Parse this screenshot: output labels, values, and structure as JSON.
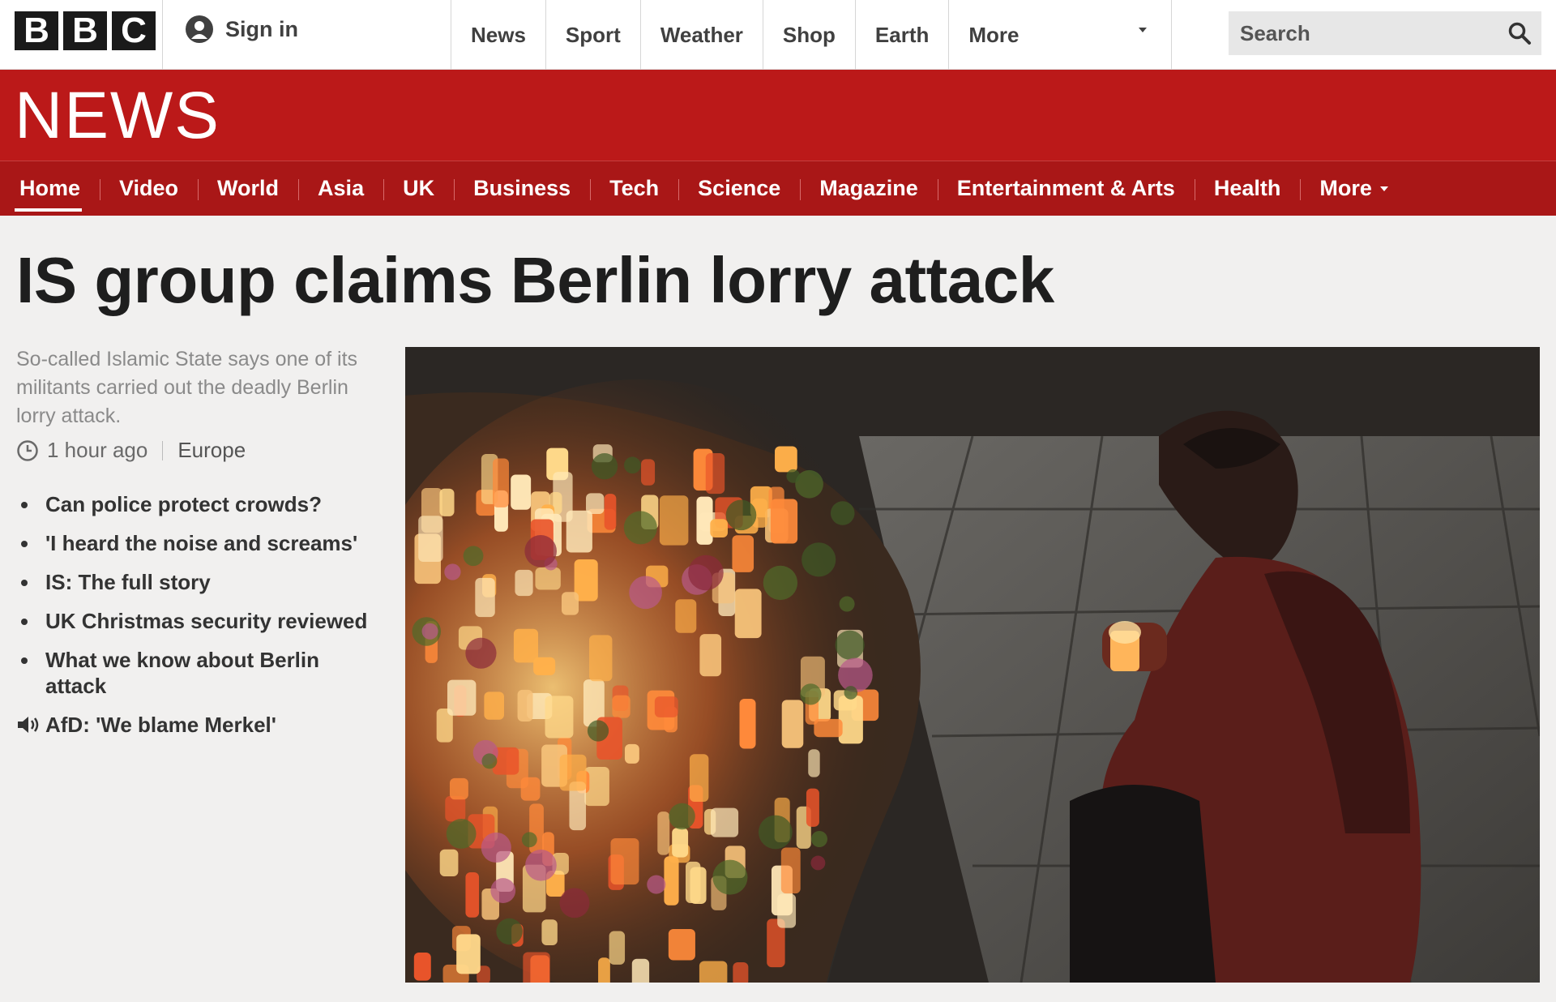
{
  "topbar": {
    "logo_letters": [
      "B",
      "B",
      "C"
    ],
    "signin_label": "Sign in",
    "nav": [
      "News",
      "Sport",
      "Weather",
      "Shop",
      "Earth",
      "More"
    ],
    "search_placeholder": "Search"
  },
  "news_header": {
    "title": "NEWS",
    "nav": [
      "Home",
      "Video",
      "World",
      "Asia",
      "UK",
      "Business",
      "Tech",
      "Science",
      "Magazine",
      "Entertainment & Arts",
      "Health",
      "More"
    ],
    "active": "Home"
  },
  "story": {
    "headline": "IS group claims Berlin lorry attack",
    "summary": "So-called Islamic State says one of its militants carried out the deadly Berlin lorry attack.",
    "time": "1 hour ago",
    "section": "Europe",
    "related": [
      "Can police protect crowds?",
      "'I heard the noise and screams'",
      "IS: The full story",
      "UK Christmas security reviewed",
      "What we know about Berlin attack"
    ],
    "audio_link": "AfD: 'We blame Merkel'"
  },
  "colors": {
    "brand_red": "#bb1919",
    "nav_red": "#a91717",
    "page_bg": "#f1f0ef"
  },
  "icons": {
    "signin": "person-icon",
    "search": "search-icon",
    "clock": "clock-icon",
    "audio": "speaker-icon"
  }
}
